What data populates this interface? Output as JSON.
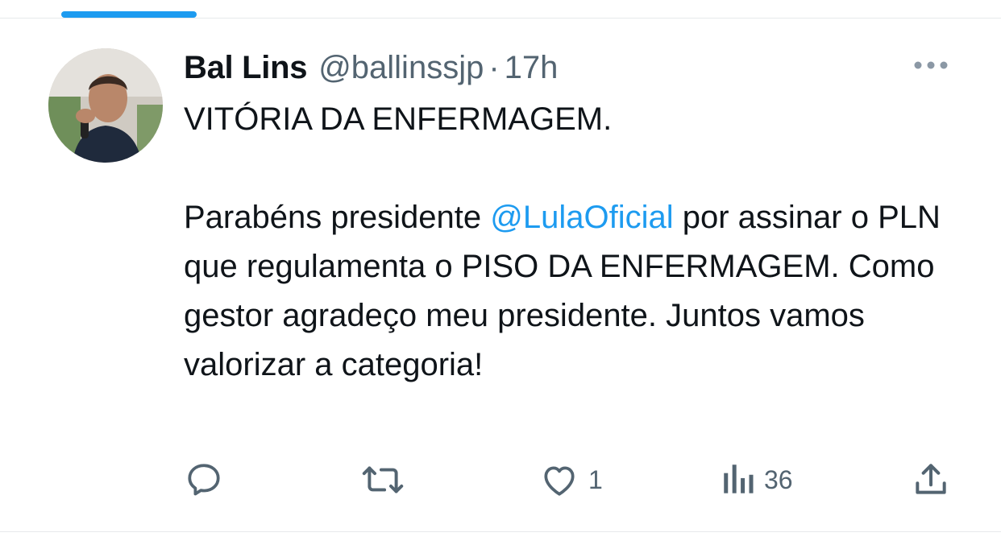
{
  "tweet": {
    "author": {
      "name": "Bal Lins",
      "handle": "@ballinssjp",
      "separator": "·",
      "time": "17h"
    },
    "text": {
      "line1": "VITÓRIA DA ENFERMAGEM.",
      "para2_before": "Parabéns presidente ",
      "mention": "@LulaOficial",
      "para2_after": " por assinar o PLN que regulamenta o PISO DA ENFERMAGEM.  Como gestor agradeço meu presidente. Juntos vamos valorizar a categoria!"
    },
    "actions": {
      "reply_icon": "reply-icon",
      "retweet_icon": "retweet-icon",
      "like_icon": "heart-icon",
      "like_count": "1",
      "views_icon": "views-icon",
      "views_count": "36",
      "share_icon": "share-icon"
    }
  },
  "colors": {
    "accent": "#1d9bf0",
    "text_primary": "#0f1419",
    "text_secondary": "#536471",
    "divider": "#e7e9eb"
  }
}
